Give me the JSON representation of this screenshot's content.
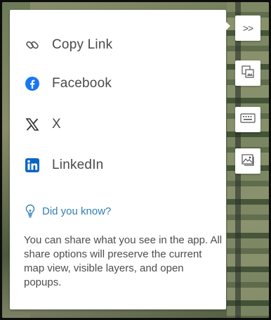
{
  "share_panel": {
    "options": [
      {
        "label": "Copy Link",
        "icon": "link-icon"
      },
      {
        "label": "Facebook",
        "icon": "facebook-icon",
        "color": "#1877F2"
      },
      {
        "label": "X",
        "icon": "x-logo-icon"
      },
      {
        "label": "LinkedIn",
        "icon": "linkedin-icon",
        "color": "#0A66C2"
      }
    ],
    "did_you_know": {
      "label": "Did you know?",
      "icon": "lightbulb-icon",
      "color": "#2F7FB8"
    },
    "description": "You can share what you see in the app. All share options will preserve the current map view, visible layers, and open popups."
  },
  "toolbar": {
    "collapse_label": ">>",
    "buttons": [
      "collapse-icon",
      "basemap-gallery-icon",
      "keyboard-icon",
      "image-icon"
    ]
  }
}
